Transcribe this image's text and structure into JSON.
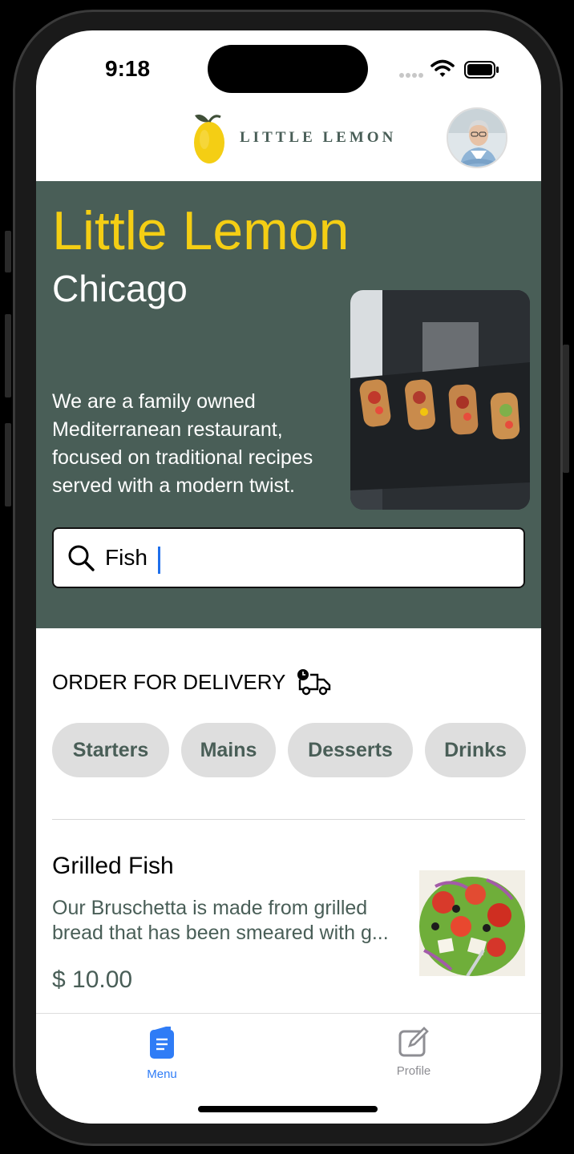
{
  "status_bar": {
    "time": "9:18"
  },
  "header": {
    "logo_text": "LITTLE LEMON"
  },
  "hero": {
    "title": "Little Lemon",
    "city": "Chicago",
    "description": "We are a family owned Mediterranean restaurant, focused on traditional recipes served with a modern twist."
  },
  "search": {
    "value": "Fish"
  },
  "delivery": {
    "label": "ORDER FOR DELIVERY"
  },
  "categories": [
    "Starters",
    "Mains",
    "Desserts",
    "Drinks"
  ],
  "menu_items": [
    {
      "title": "Grilled Fish",
      "description": "Our Bruschetta is made from grilled bread that has been smeared with g...",
      "price": "$ 10.00"
    }
  ],
  "tabs": [
    {
      "label": "Menu",
      "icon": "menu-book-icon",
      "active": true
    },
    {
      "label": "Profile",
      "icon": "edit-square-icon",
      "active": false
    }
  ],
  "colors": {
    "primary_green": "#495e57",
    "accent_yellow": "#f4ce14",
    "active_tab": "#2f7cf6",
    "inactive_tab": "#8e8e93"
  }
}
